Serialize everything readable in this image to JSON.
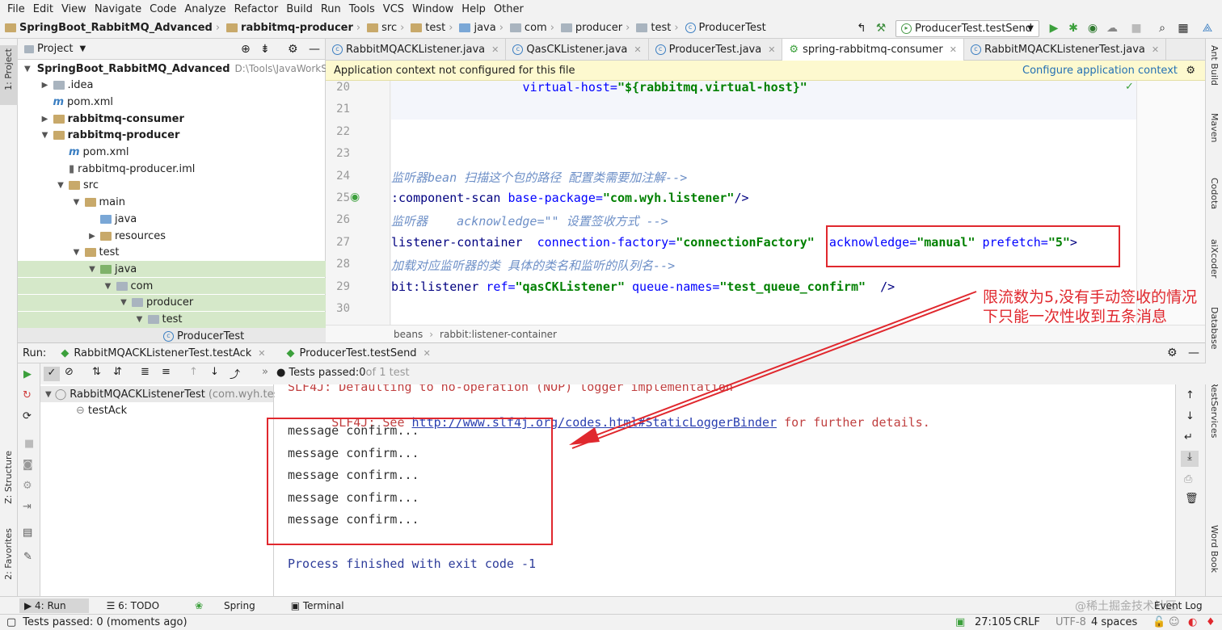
{
  "menu": [
    "File",
    "Edit",
    "View",
    "Navigate",
    "Code",
    "Analyze",
    "Refactor",
    "Build",
    "Run",
    "Tools",
    "VCS",
    "Window",
    "Help",
    "Other"
  ],
  "nav": {
    "breadcrumb": [
      "SpringBoot_RabbitMQ_Advanced",
      "rabbitmq-producer",
      "src",
      "test",
      "java",
      "com",
      "producer",
      "test",
      "ProducerTest"
    ]
  },
  "toolbar": {
    "run_config": "ProducerTest.testSend"
  },
  "left_strip": {
    "project": "1: Project",
    "structure": "Z: Structure",
    "favorites": "2: Favorites"
  },
  "right_strip": [
    "Ant Build",
    "Maven",
    "Codota",
    "aiXcoder",
    "Database",
    "RestServices",
    "Word Book"
  ],
  "project": {
    "title": "Project",
    "tree": [
      {
        "label": "SpringBoot_RabbitMQ_Advanced",
        "extra": "D:\\Tools\\JavaWorkSpace",
        "indent": 0,
        "arrow": "▼",
        "icon": "folder",
        "bold": true
      },
      {
        "label": ".idea",
        "indent": 1,
        "arrow": "▶",
        "icon": "folder-gray"
      },
      {
        "label": "pom.xml",
        "indent": 1,
        "arrow": "",
        "icon": "maven"
      },
      {
        "label": "rabbitmq-consumer",
        "indent": 1,
        "arrow": "▶",
        "icon": "folder",
        "bold": true
      },
      {
        "label": "rabbitmq-producer",
        "indent": 1,
        "arrow": "▼",
        "icon": "folder",
        "bold": true
      },
      {
        "label": "pom.xml",
        "indent": 2,
        "arrow": "",
        "icon": "maven"
      },
      {
        "label": "rabbitmq-producer.iml",
        "indent": 2,
        "arrow": "",
        "icon": "file"
      },
      {
        "label": "src",
        "indent": 2,
        "arrow": "▼",
        "icon": "folder"
      },
      {
        "label": "main",
        "indent": 3,
        "arrow": "▼",
        "icon": "folder"
      },
      {
        "label": "java",
        "indent": 4,
        "arrow": "",
        "icon": "folder-blue"
      },
      {
        "label": "resources",
        "indent": 4,
        "arrow": "▶",
        "icon": "folder"
      },
      {
        "label": "test",
        "indent": 3,
        "arrow": "▼",
        "icon": "folder"
      },
      {
        "label": "java",
        "indent": 4,
        "arrow": "▼",
        "icon": "folder-green",
        "sel": true
      },
      {
        "label": "com",
        "indent": 5,
        "arrow": "▼",
        "icon": "folder-gray",
        "sel": true
      },
      {
        "label": "producer",
        "indent": 6,
        "arrow": "▼",
        "icon": "folder-gray",
        "sel": true
      },
      {
        "label": "test",
        "indent": 7,
        "arrow": "▼",
        "icon": "folder-gray",
        "sel": true
      },
      {
        "label": "ProducerTest",
        "indent": 8,
        "arrow": "",
        "icon": "class",
        "sel2": true
      }
    ]
  },
  "editor_tabs": [
    {
      "label": "RabbitMQACKListener.java",
      "active": false
    },
    {
      "label": "QasCKListener.java",
      "active": false
    },
    {
      "label": "ProducerTest.java",
      "active": false
    },
    {
      "label": "spring-rabbitmq-consumer",
      "active": true
    },
    {
      "label": "RabbitMQACKListenerTest.java",
      "active": false
    }
  ],
  "notice": {
    "text": "Application context not configured for this file",
    "link": "Configure application context"
  },
  "code": {
    "line_numbers": [
      "20",
      "21",
      "22",
      "23",
      "24",
      "25",
      "26",
      "27",
      "28",
      "29",
      "30"
    ],
    "lines": [
      [
        {
          "t": "                  virtual-host=",
          "c": "at"
        },
        {
          "t": "\"${rabbitmq.virtual-host}\"",
          "c": "vl"
        }
      ],
      [],
      [],
      [],
      [
        {
          "t": "监听器bean 扫描这个包的路径 配置类需要加注解-->",
          "c": "cm"
        }
      ],
      [
        {
          "t": ":component-scan ",
          "c": "tg"
        },
        {
          "t": "base-package=",
          "c": "at"
        },
        {
          "t": "\"com.wyh.listener\"",
          "c": "vl"
        },
        {
          "t": "/>",
          "c": "tg"
        }
      ],
      [
        {
          "t": "监听器    acknowledge=\"\" 设置签收方式 -->",
          "c": "cm"
        }
      ],
      [
        {
          "t": "listener-container  ",
          "c": "tg"
        },
        {
          "t": "connection-factory=",
          "c": "at"
        },
        {
          "t": "\"connectionFactory\"",
          "c": "vl"
        },
        {
          "t": "  acknowledge=",
          "c": "at"
        },
        {
          "t": "\"manual\"",
          "c": "vl"
        },
        {
          "t": " prefetch=",
          "c": "at"
        },
        {
          "t": "\"5\"",
          "c": "vl"
        },
        {
          "t": ">",
          "c": "tg"
        }
      ],
      [
        {
          "t": "加载对应监听器的类 具体的类名和监听的队列名-->",
          "c": "cm"
        }
      ],
      [
        {
          "t": "bit:listener ",
          "c": "tg"
        },
        {
          "t": "ref=",
          "c": "at"
        },
        {
          "t": "\"qasCKListener\"",
          "c": "vl"
        },
        {
          "t": " queue-names=",
          "c": "at"
        },
        {
          "t": "\"test_queue_confirm\"",
          "c": "vl"
        },
        {
          "t": "  />",
          "c": "tg"
        }
      ],
      []
    ]
  },
  "editor_breadcrumb": [
    "beans",
    "rabbit:listener-container"
  ],
  "run": {
    "label": "Run:",
    "tabs": [
      "RabbitMQACKListenerTest.testAck",
      "ProducerTest.testSend"
    ],
    "status_prefix": "Tests passed: ",
    "status_count": "0",
    "status_suffix": " of 1 test",
    "tree_root": "RabbitMQACKListenerTest",
    "tree_root_pkg": "(com.wyh.test)",
    "tree_child": "testAck"
  },
  "console": {
    "line_top": "SLF4J: Defaulting to no-operation (NOP) logger implementation",
    "line_see_prefix": "SLF4J: See ",
    "line_see_link": "http://www.slf4j.org/codes.html#StaticLoggerBinder",
    "line_see_suffix": " for further details.",
    "messages": [
      "message confirm...",
      "message confirm...",
      "message confirm...",
      "message confirm...",
      "message confirm..."
    ],
    "exit": "Process finished with exit code -1"
  },
  "annotation": {
    "line1": "限流数为5,没有手动签收的情况",
    "line2": "下只能一次性收到五条消息"
  },
  "bottom_tabs": [
    "4: Run",
    "6: TODO",
    "Spring",
    "Terminal"
  ],
  "event_log": "Event Log",
  "watermark": "@稀土掘金技术社区",
  "status": {
    "text": "Tests passed: 0 (moments ago)",
    "position": "27:105",
    "line_sep": "CRLF",
    "encoding": "UTF-8",
    "indent": "4 spaces"
  },
  "colors": {
    "annotation": "#e0282e",
    "selection": "#d5e8c9",
    "link": "#2470b3"
  }
}
